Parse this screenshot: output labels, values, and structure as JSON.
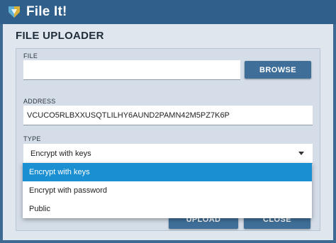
{
  "window": {
    "title": "File It!"
  },
  "panel": {
    "title": "FILE UPLOADER"
  },
  "form": {
    "file": {
      "label": "FILE",
      "value": ""
    },
    "browse_label": "BROWSE",
    "address": {
      "label": "ADDRESS",
      "value": "VCUCO5RLBXXUSQTLILHY6AUND2PAMN42M5PZ7K6P"
    },
    "type": {
      "label": "TYPE",
      "selected": "Encrypt with keys",
      "options": [
        "Encrypt with keys",
        "Encrypt with password",
        "Public"
      ]
    }
  },
  "footer": {
    "upload_label": "UPLOAD",
    "close_label": "CLOSE"
  },
  "colors": {
    "titlebar": "#2f5f8a",
    "accent": "#3f6f99",
    "selection": "#1a8fd1",
    "panel": "#dfe6ee"
  }
}
